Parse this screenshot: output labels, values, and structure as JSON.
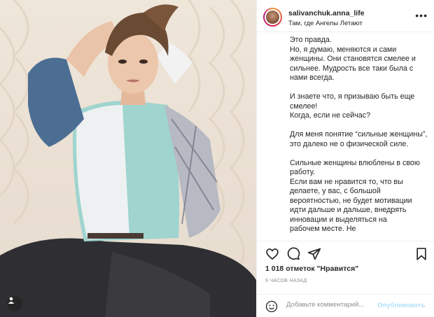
{
  "post": {
    "username": "salivanchuk.anna_life",
    "location": "Там, где Ангелы Летают",
    "more_icon": "more-horizontal-icon",
    "caption": "Это правда.\nНо, я думаю, меняются и сами женщины. Они становятся смелее и сильнее. Мудрость все таки была с нами всегда.\n\nИ знаете что, я призываю быть еще смелее!\nКогда, если не сейчас?\n\nДля меня понятие “сильные женщины”, это далеко не о физической силе.\n\nСильные женщины влюблены в свою работу.\nЕсли вам не нравится то, что вы делаете, у вас, с большой вероятностью, не будет мотивации идти дальше и дальше, внедрять инновации и выделяться на\nрабочем месте. Не"
  },
  "actions": {
    "like_icon": "heart-icon",
    "comment_icon": "comment-icon",
    "share_icon": "paper-plane-icon",
    "save_icon": "bookmark-icon"
  },
  "likes_text": "1 018 отметок \"Нравится\"",
  "time_text": "9 ЧАСОВ НАЗАД",
  "comment": {
    "emoji_icon": "emoji-icon",
    "placeholder": "Добавьте комментарий...",
    "publish_label": "Опубликовать"
  },
  "photo": {
    "tag_icon": "user-tag-icon"
  },
  "colors": {
    "text": "#262626",
    "muted": "#8e8e8e",
    "publish_disabled": "#b2dffc",
    "divider": "#efefef"
  }
}
